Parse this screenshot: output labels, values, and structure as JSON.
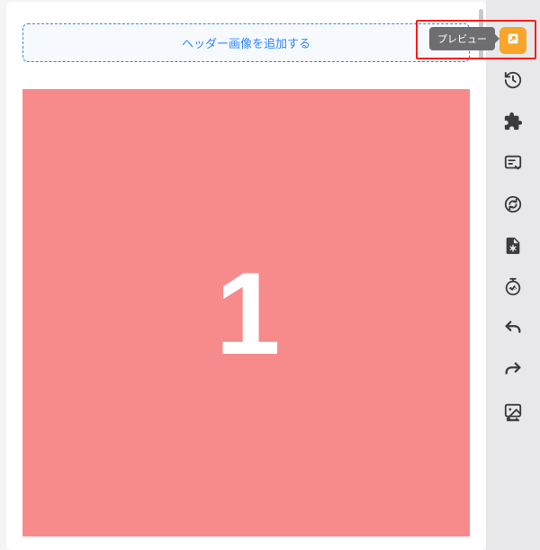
{
  "editor": {
    "header_add_label": "ヘッダー画像を追加する",
    "image_number": "1"
  },
  "tooltip": {
    "preview": "プレビュー"
  },
  "colors": {
    "accent_blue": "#2e86ff",
    "image_bg": "#f78b8b",
    "preview_btn": "#f7a52b",
    "highlight": "#ff1a1a"
  },
  "toolbar": {
    "items": [
      "preview-icon",
      "history-icon",
      "extension-icon",
      "form-icon",
      "sync-icon",
      "file-settings-icon",
      "timer-icon",
      "undo-icon",
      "redo-icon",
      "image-swap-icon"
    ]
  }
}
